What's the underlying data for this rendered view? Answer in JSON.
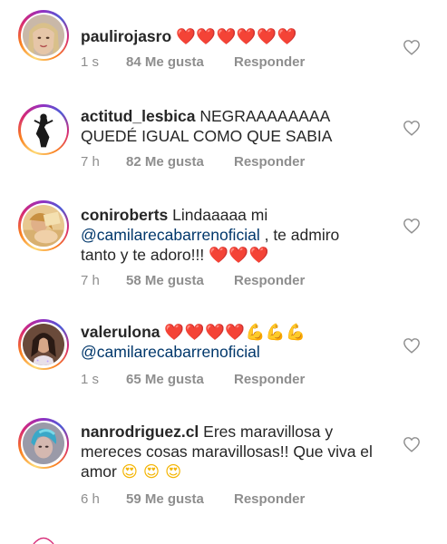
{
  "comments": [
    {
      "username": "paulirojasro",
      "text": "",
      "emojis": "❤️❤️❤️❤️❤️❤️",
      "time": "1 s",
      "likes": "84 Me gusta",
      "reply": "Responder"
    },
    {
      "username": "actitud_lesbica",
      "text": "NEGRAAAAAAAA QUEDÉ IGUAL COMO QUE SABIA",
      "emojis": "",
      "time": "7 h",
      "likes": "82 Me gusta",
      "reply": "Responder"
    },
    {
      "username": "coniroberts",
      "text_before": "Lindaaaaa mi",
      "mention": "@camilarecabarrenoficial",
      "text_after": ", te admiro tanto y te adoro!!!",
      "emojis": "❤️❤️❤️",
      "time": "7 h",
      "likes": "58 Me gusta",
      "reply": "Responder"
    },
    {
      "username": "valerulona",
      "emojis": "❤️❤️❤️❤️💪💪💪",
      "mention": "@camilarecabarrenoficial",
      "time": "1 s",
      "likes": "65 Me gusta",
      "reply": "Responder"
    },
    {
      "username": "nanrodriguez.cl",
      "text": "Eres maravillosa y mereces cosas maravillosas!! Que viva el amor",
      "emojis": "😍 😍 😍",
      "time": "6 h",
      "likes": "59 Me gusta",
      "reply": "Responder"
    }
  ],
  "icons": {
    "like": "heart-outline-icon",
    "avatar_ring_colors": [
      "#feda75",
      "#fa7e1e",
      "#d62976",
      "#962fbf",
      "#4f5bd5"
    ]
  },
  "colors": {
    "text": "#262626",
    "meta": "#8e8e8e",
    "mention": "#00376b",
    "heart_emoji": "#ed1c24"
  }
}
